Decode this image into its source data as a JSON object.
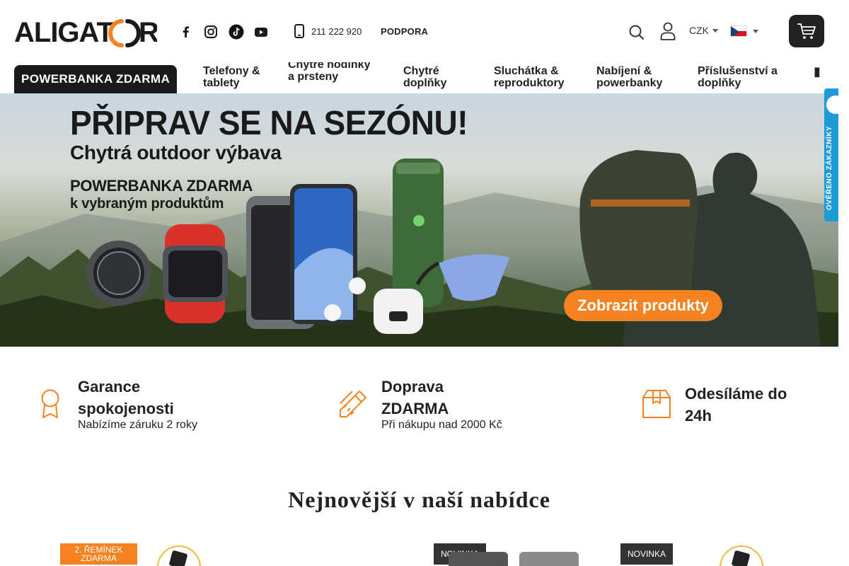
{
  "brand": {
    "logo_text": "ALIGATOR"
  },
  "header": {
    "social": [
      "facebook-icon",
      "instagram-icon",
      "tiktok-icon",
      "youtube-icon"
    ],
    "phone": "211 222 920",
    "support_label": "PODPORA",
    "currency": "CZK",
    "language_flag": "czech-flag-icon",
    "colors": {
      "accent": "#f58220",
      "dark": "#1a1a1a"
    }
  },
  "nav": {
    "promo_label": "POWERBANKA ZDARMA",
    "items": [
      {
        "label": "Telefony & tablety"
      },
      {
        "label": "Chytré hodinky a prsteny"
      },
      {
        "label": "Chytré doplňky"
      },
      {
        "label": "Sluchátka & reproduktory"
      },
      {
        "label": "Nabíjení & powerbanky"
      },
      {
        "label": "Příslušenství a doplňky"
      }
    ]
  },
  "banner": {
    "title": "PŘIPRAV SE NA SEZÓNU!",
    "subtitle": "Chytrá outdoor výbava",
    "promo_line1": "POWERBANKA ZDARMA",
    "promo_line2": "k vybraným produktům",
    "cta_label": "Zobrazit produkty",
    "verified_label": "OVĚŘENO ZÁKAZNÍKY"
  },
  "features": [
    {
      "title": "Garance spokojenosti",
      "desc": "Nabízíme záruku 2 roky",
      "icon": "award-ribbon-icon"
    },
    {
      "title": "Doprava ZDARMA",
      "desc": "Při nákupu nad 2000 Kč",
      "icon": "pencil-ruler-icon"
    },
    {
      "title": "Odesíláme do 24h",
      "desc": "",
      "icon": "package-box-icon"
    }
  ],
  "newest": {
    "title": "Nejnovější v naší nabídce",
    "badges": [
      "2. ŘEMÍNEK ZDARMA",
      "NOVINKA",
      "NOVINKA"
    ]
  }
}
